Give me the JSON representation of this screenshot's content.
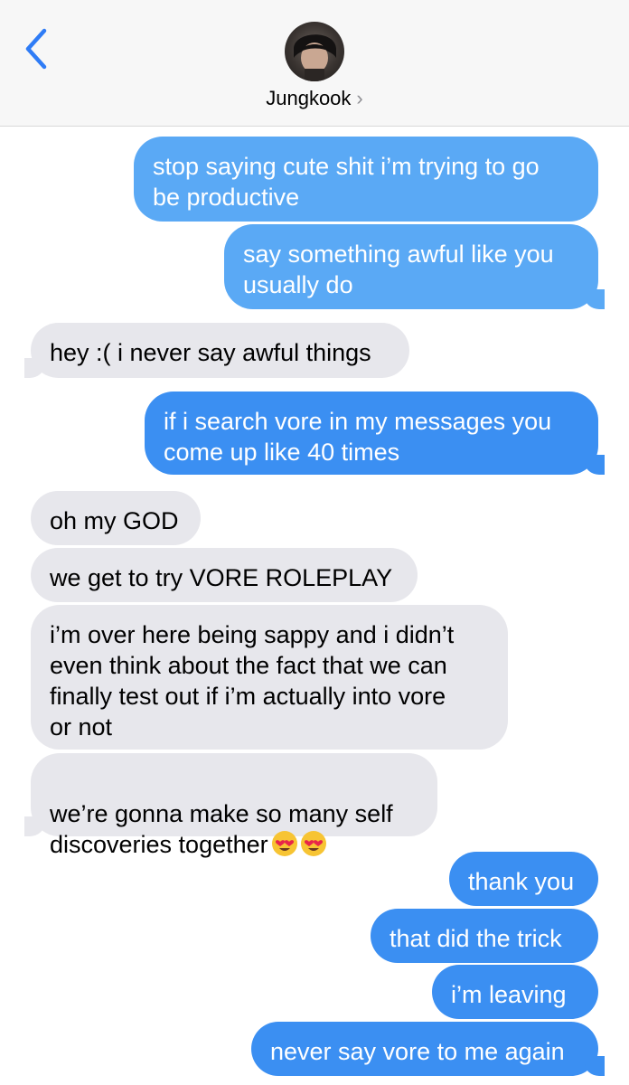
{
  "header": {
    "contact_name": "Jungkook",
    "chevron": "›"
  },
  "messages": [
    {
      "side": "sent",
      "text": "stop saying cute shit i’m trying to go\nbe productive"
    },
    {
      "side": "sent",
      "text": "say something awful like you\nusually do"
    },
    {
      "side": "received",
      "text": "hey :( i never say awful things"
    },
    {
      "side": "sent",
      "text": "if i search vore in my messages you\ncome up like 40 times"
    },
    {
      "side": "received",
      "text": "oh my GOD"
    },
    {
      "side": "received",
      "text": "we get to try VORE ROLEPLAY"
    },
    {
      "side": "received",
      "text": "i’m over here being sappy and i didn’t\neven think about the fact that we can\nfinally test out if i’m actually into vore\nor not"
    },
    {
      "side": "received",
      "text": "we’re gonna make so many self\ndiscoveries together"
    },
    {
      "side": "sent",
      "text": "thank you"
    },
    {
      "side": "sent",
      "text": "that did the trick"
    },
    {
      "side": "sent",
      "text": "i’m leaving"
    },
    {
      "side": "sent",
      "text": "never say vore to me again"
    }
  ],
  "emojis": [
    "heart-eyes-emoji",
    "heart-eyes-emoji"
  ],
  "colors": {
    "sent_bubble_light": "#5aa9f5",
    "sent_bubble": "#3b8ff2",
    "received_bubble": "#e7e7ec",
    "accent": "#2f7cf6"
  }
}
